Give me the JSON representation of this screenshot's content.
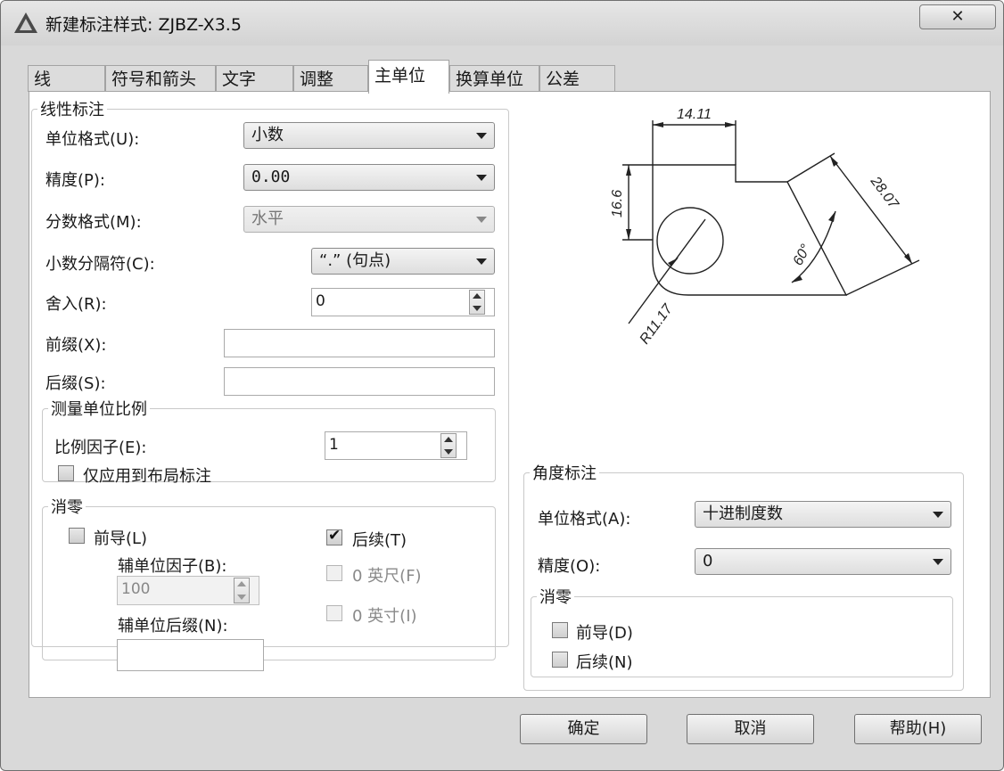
{
  "window": {
    "title": "新建标注样式: ZJBZ-X3.5",
    "close_symbol": "✕"
  },
  "tabs": [
    "线",
    "符号和箭头",
    "文字",
    "调整",
    "主单位",
    "换算单位",
    "公差"
  ],
  "linear": {
    "legend": "线性标注",
    "unit_format_label": "单位格式(U):",
    "unit_format_value": "小数",
    "precision_label": "精度(P):",
    "precision_value": "0.00",
    "fraction_format_label": "分数格式(M):",
    "fraction_format_value": "水平",
    "decimal_separator_label": "小数分隔符(C):",
    "decimal_separator_value": "“.” (句点)",
    "round_off_label": "舍入(R):",
    "round_off_value": "0",
    "prefix_label": "前缀(X):",
    "prefix_value": "",
    "suffix_label": "后缀(S):",
    "suffix_value": ""
  },
  "scale": {
    "legend": "测量单位比例",
    "factor_label": "比例因子(E):",
    "factor_value": "1",
    "layout_only_label": "仅应用到布局标注",
    "layout_only_checked": false
  },
  "zero_linear": {
    "legend": "消零",
    "leading_label": "前导(L)",
    "leading_checked": false,
    "sub_factor_label": "辅单位因子(B):",
    "sub_factor_value": "100",
    "sub_suffix_label": "辅单位后缀(N):",
    "sub_suffix_value": "",
    "trailing_label": "后续(T)",
    "trailing_checked": true,
    "feet_label": "0 英尺(F)",
    "inch_label": "0 英寸(I)"
  },
  "preview": {
    "dim_top": "14.11",
    "dim_left": "16.6",
    "dim_diag": "28.07",
    "dim_angle": "60°",
    "dim_radius": "R11.17"
  },
  "angular": {
    "legend": "角度标注",
    "unit_format_label": "单位格式(A):",
    "unit_format_value": "十进制度数",
    "precision_label": "精度(O):",
    "precision_value": "0",
    "zero_legend": "消零",
    "leading_label": "前导(D)",
    "leading_checked": false,
    "trailing_label": "后续(N)",
    "trailing_checked": false
  },
  "buttons": {
    "ok": "确定",
    "cancel": "取消",
    "help": "帮助(H)"
  }
}
